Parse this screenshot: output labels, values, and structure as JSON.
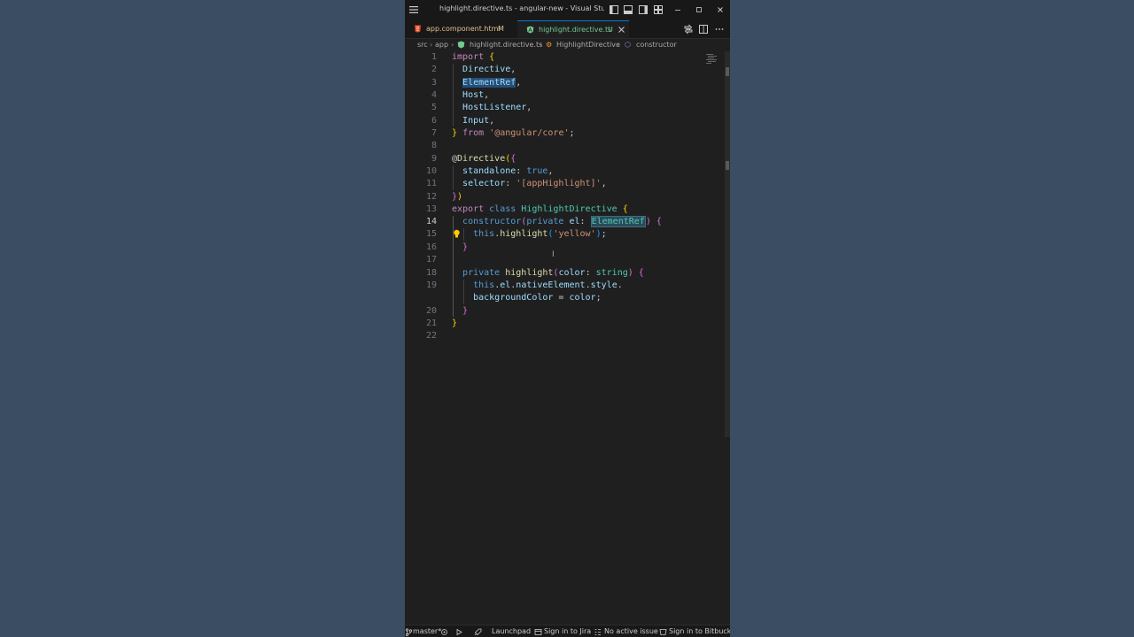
{
  "window": {
    "title": "highlight.directive.ts - angular-new - Visual Studio ..."
  },
  "tabs": [
    {
      "label": "app.component.html",
      "status": "M"
    },
    {
      "label": "highlight.directive.ts",
      "status": "U"
    }
  ],
  "breadcrumb": [
    "src",
    "app",
    "highlight.directive.ts",
    "HighlightDirective",
    "constructor"
  ],
  "editor": {
    "active_line": 14,
    "line_numbers": [
      "1",
      "2",
      "3",
      "4",
      "5",
      "6",
      "7",
      "8",
      "9",
      "10",
      "11",
      "12",
      "13",
      "14",
      "15",
      "16",
      "17",
      "18",
      "19",
      "20",
      "21",
      "22"
    ]
  },
  "code": {
    "l1_import": "import",
    "l1_brace": "{",
    "l2": "Directive",
    "l3": "ElementRef",
    "l4": "Host",
    "l5": "HostListener",
    "l6": "Input",
    "l7_brace": "}",
    "l7_from": "from",
    "l7_str": "'@angular/core'",
    "l9_at": "@",
    "l9_dec": "Directive",
    "l10_key": "standalone",
    "l10_val": "true",
    "l11_key": "selector",
    "l11_val": "'[appHighlight]'",
    "l13_export": "export",
    "l13_class": "class",
    "l13_name": "HighlightDirective",
    "l14_ctor": "constructor",
    "l14_private": "private",
    "l14_el": "el",
    "l14_type": "ElementRef",
    "l15_this": "this",
    "l15_fn": "highlight",
    "l15_str": "'yellow'",
    "l18_private": "private",
    "l18_fn": "highlight",
    "l18_param": "color",
    "l18_type": "string",
    "l19_this": "this",
    "l19_el": "el",
    "l19_ne": "nativeElement",
    "l19_style": "style",
    "l19b_prop": "backgroundColor",
    "l19b_val": "color"
  },
  "statusbar": {
    "branch": "master*",
    "launchpad": "Launchpad",
    "jira": "Sign in to Jira",
    "issue": "No active issue",
    "bitbucket": "Sign in to Bitbucket"
  },
  "colors": {
    "accent": "#0078d4",
    "modified": "#e2c08d",
    "untracked": "#73c991",
    "background": "#3a4d63",
    "editor_bg": "#1f1f1f"
  }
}
